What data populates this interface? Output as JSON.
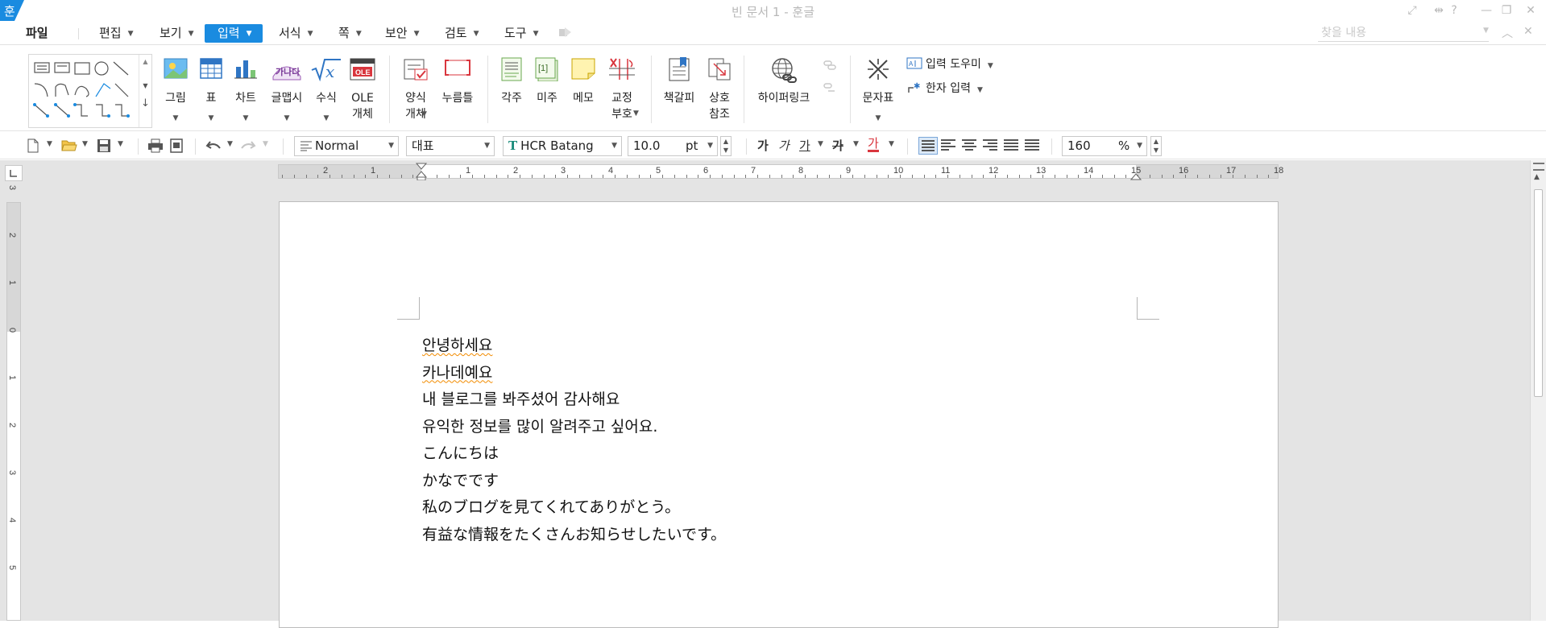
{
  "window": {
    "title": "빈 문서 1 - 훈글",
    "logo_glyph": "훈",
    "controls": [
      "⤢",
      "⇹",
      "?",
      "—",
      "❐",
      "✕"
    ]
  },
  "menu": {
    "items": [
      {
        "label": "파일",
        "has_caret": false
      },
      {
        "label": "편집",
        "has_caret": true
      },
      {
        "label": "보기",
        "has_caret": true
      },
      {
        "label": "입력",
        "has_caret": true,
        "active": true
      },
      {
        "label": "서식",
        "has_caret": true
      },
      {
        "label": "쪽",
        "has_caret": true
      },
      {
        "label": "보안",
        "has_caret": true
      },
      {
        "label": "검토",
        "has_caret": true
      },
      {
        "label": "도구",
        "has_caret": true
      }
    ],
    "search_placeholder": "찾을 내용"
  },
  "ribbon": {
    "buttons": [
      {
        "id": "picture",
        "label": "그림",
        "dropdown": true
      },
      {
        "id": "table",
        "label": "표",
        "dropdown": true
      },
      {
        "id": "chart",
        "label": "차트",
        "dropdown": true
      },
      {
        "id": "textart",
        "label": "글맵시",
        "dropdown": true
      },
      {
        "id": "equation",
        "label": "수식",
        "dropdown": true
      },
      {
        "id": "ole",
        "label": "OLE\n개체",
        "dropdown": false
      },
      {
        "id": "form",
        "label": "양식\n개체",
        "dropdown": true
      },
      {
        "id": "pressframe",
        "label": "누름틀",
        "dropdown": false
      },
      {
        "id": "footnote",
        "label": "각주",
        "dropdown": false
      },
      {
        "id": "endnote",
        "label": "미주",
        "dropdown": false
      },
      {
        "id": "memo",
        "label": "메모",
        "dropdown": false
      },
      {
        "id": "proofmark",
        "label": "교정\n부호",
        "dropdown": true
      },
      {
        "id": "bookmark",
        "label": "책갈피",
        "dropdown": false
      },
      {
        "id": "crossref",
        "label": "상호\n참조",
        "dropdown": false
      },
      {
        "id": "hyperlink",
        "label": "하이퍼링크",
        "dropdown": false
      },
      {
        "id": "symbols",
        "label": "문자표",
        "dropdown": true
      }
    ],
    "ole_badge": "OLE",
    "textart_badge": "가나다",
    "endnote_badge": "[1]",
    "input_helper": "입력 도우미",
    "hanja_input": "한자 입력"
  },
  "toolbar": {
    "style": "Normal",
    "font_lang": "대표",
    "font_name": "HCR Batang",
    "font_size": "10.0",
    "font_unit": "pt",
    "zoom": "160",
    "zoom_unit": "%",
    "format_glyphs": [
      "가",
      "가",
      "가",
      "가",
      "가"
    ]
  },
  "ruler": {
    "horizontal_labels": [
      "2",
      "1",
      "1",
      "2",
      "3",
      "4",
      "5",
      "6",
      "7",
      "8",
      "9",
      "10",
      "11",
      "12",
      "13",
      "14",
      "15",
      "16",
      "17",
      "18"
    ],
    "vertical_labels": [
      "3",
      "2",
      "1",
      "0",
      "1",
      "2",
      "3",
      "4",
      "5"
    ]
  },
  "document": {
    "lines": [
      "안녕하세요",
      "카나데예요",
      "내 블로그를 봐주셨어 감사해요",
      "유익한 정보를 많이 알려주고 싶어요.",
      "こんにちは",
      "かなでです",
      "私のブログを見てくれてありがとう。",
      "有益な情報をたくさんお知らせしたいです。"
    ]
  },
  "colors": {
    "accent": "#1a8be0",
    "spellcheck": "#f28b00",
    "workspace": "#e4e4e4"
  }
}
